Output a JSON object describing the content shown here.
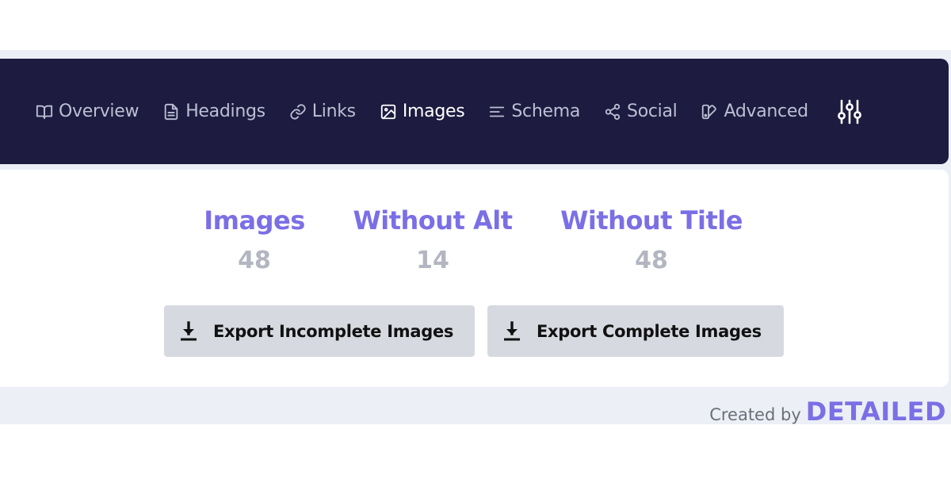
{
  "nav": {
    "items": [
      {
        "label": "Overview",
        "icon": "book-icon",
        "active": false
      },
      {
        "label": "Headings",
        "icon": "document-icon",
        "active": false
      },
      {
        "label": "Links",
        "icon": "link-icon",
        "active": false
      },
      {
        "label": "Images",
        "icon": "image-icon",
        "active": true
      },
      {
        "label": "Schema",
        "icon": "align-left-icon",
        "active": false
      },
      {
        "label": "Social",
        "icon": "share-icon",
        "active": false
      },
      {
        "label": "Advanced",
        "icon": "palette-icon",
        "active": false
      }
    ],
    "settings_icon": "sliders-icon"
  },
  "stats": [
    {
      "label": "Images",
      "value": "48"
    },
    {
      "label": "Without Alt",
      "value": "14"
    },
    {
      "label": "Without Title",
      "value": "48"
    }
  ],
  "buttons": {
    "export_incomplete": "Export Incomplete Images",
    "export_complete": "Export Complete Images"
  },
  "footer": {
    "created_by": "Created by",
    "brand": "DETAILED"
  },
  "colors": {
    "nav_background": "#1d1b3f",
    "accent": "#7b6fe6",
    "stat_value": "#b3b6c0",
    "button_background": "#d6d9df",
    "panel_background": "#eceff6"
  }
}
